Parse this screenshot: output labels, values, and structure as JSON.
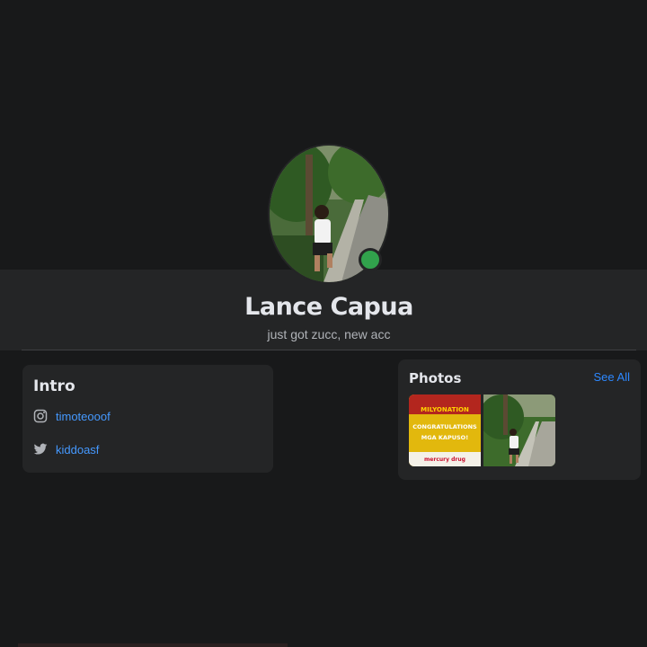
{
  "profile": {
    "name": "Lance Capua",
    "bio": "just got zucc, new acc",
    "online_color": "#31a24c"
  },
  "intro": {
    "title": "Intro",
    "links": [
      {
        "icon": "instagram-icon",
        "label": "timoteooof"
      },
      {
        "icon": "twitter-icon",
        "label": "kiddoasf"
      }
    ]
  },
  "photos": {
    "title": "Photos",
    "see_all": "See All",
    "items": [
      {
        "label_lines": [
          "MILYONATION",
          "CONGRATULATIONS",
          "MGA KAPUSO!",
          "mercury drug"
        ]
      },
      {
        "description": "person-on-road"
      }
    ]
  },
  "colors": {
    "background": "#18191a",
    "card": "#242526",
    "link": "#4599ff",
    "accent": "#2d88ff"
  }
}
